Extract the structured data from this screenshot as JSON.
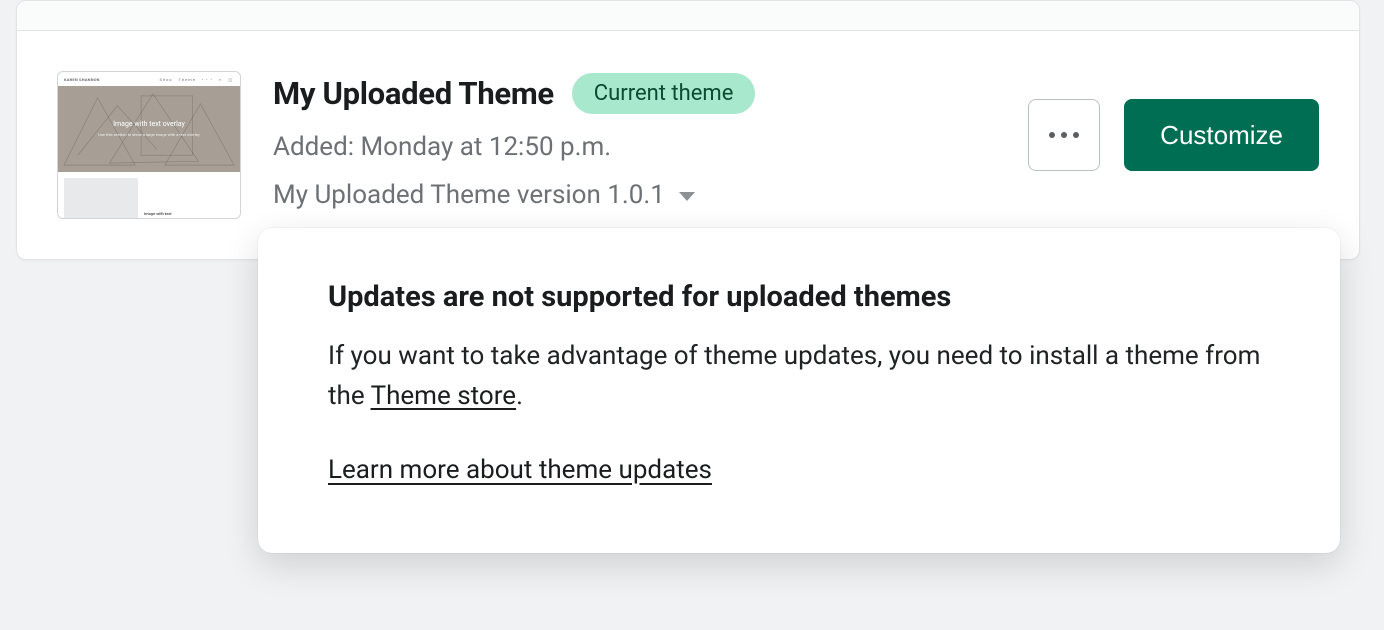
{
  "theme": {
    "title": "My Uploaded Theme",
    "badge": "Current theme",
    "added_line": "Added: Monday at 12:50 p.m.",
    "version_line": "My Uploaded Theme version 1.0.1"
  },
  "actions": {
    "customize_label": "Customize"
  },
  "thumbnail": {
    "hero_text": "Image with text overlay",
    "side_text": "Image with text"
  },
  "popover": {
    "heading": "Updates are not supported for uploaded themes",
    "body_prefix": "If you want to take advantage of theme updates, you need to install a theme from the ",
    "body_link": "Theme store",
    "body_suffix": ".",
    "learn_more": "Learn more about theme updates"
  }
}
